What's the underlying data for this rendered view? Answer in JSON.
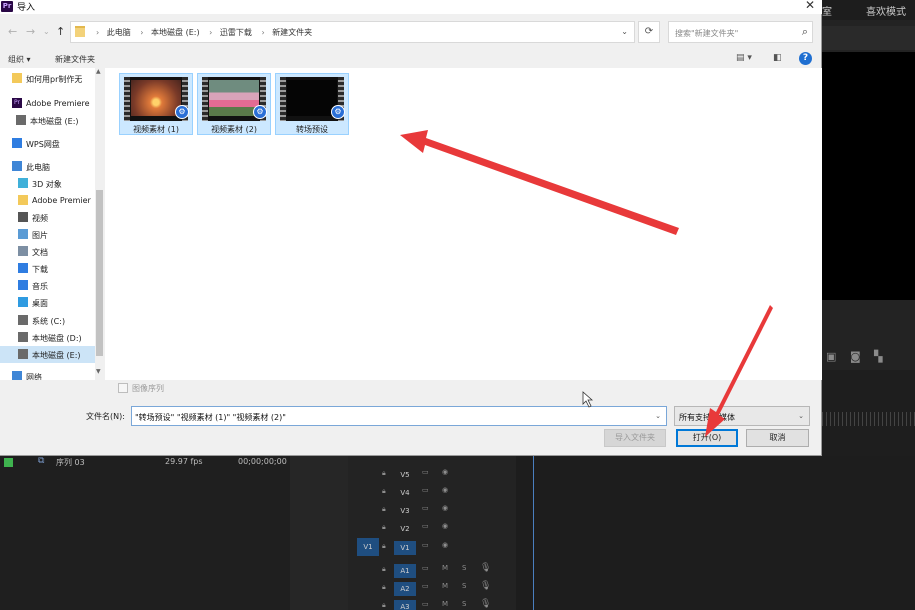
{
  "premiere": {
    "top_right_items": [
      "室",
      "喜欢模式"
    ],
    "project": {
      "sequence": "序列 03",
      "fps": "29.97 fps",
      "timecode": "00;00;00;00"
    },
    "tracks": [
      {
        "name": "V5"
      },
      {
        "name": "V4"
      },
      {
        "name": "V3"
      },
      {
        "name": "V2"
      },
      {
        "name": "V1",
        "source": "V1"
      },
      {
        "name": "A1"
      },
      {
        "name": "A2"
      },
      {
        "name": "A3"
      }
    ],
    "track_toggles": {
      "mute": "M",
      "solo": "S"
    }
  },
  "dialog": {
    "title": "导入",
    "app_icon_text": "Pr",
    "close_glyph": "✕",
    "nav": {
      "back": "←",
      "forward": "→",
      "recent": "⌄",
      "up": "↑"
    },
    "address": {
      "crumbs": [
        "此电脑",
        "本地磁盘 (E:)",
        "迅雷下载",
        "新建文件夹"
      ],
      "separator": "›",
      "dropdown": "⌄"
    },
    "refresh_glyph": "⟳",
    "search": {
      "placeholder": "搜索\"新建文件夹\"",
      "glyph": "⌕"
    },
    "toolbar": {
      "organize": "组织 ▾",
      "new_folder": "新建文件夹",
      "help": "?"
    },
    "sidebar": {
      "items": [
        {
          "label": "如何用pr制作无",
          "icon": "folder-icon"
        },
        {
          "label": "Adobe Premiere",
          "icon": "premiere-icon"
        },
        {
          "label": "本地磁盘 (E:)",
          "icon": "drive-icon"
        },
        {
          "label": "WPS网盘",
          "icon": "cloud-icon"
        },
        {
          "label": "此电脑",
          "icon": "computer-icon"
        },
        {
          "label": "3D 对象",
          "icon": "cube-icon"
        },
        {
          "label": "Adobe Premier",
          "icon": "folder-icon"
        },
        {
          "label": "视频",
          "icon": "video-icon"
        },
        {
          "label": "图片",
          "icon": "picture-icon"
        },
        {
          "label": "文档",
          "icon": "document-icon"
        },
        {
          "label": "下载",
          "icon": "download-icon"
        },
        {
          "label": "音乐",
          "icon": "music-icon"
        },
        {
          "label": "桌面",
          "icon": "desktop-icon"
        },
        {
          "label": "系统 (C:)",
          "icon": "drive-icon"
        },
        {
          "label": "本地磁盘 (D:)",
          "icon": "drive-icon"
        },
        {
          "label": "本地磁盘 (E:)",
          "icon": "drive-icon",
          "selected": true
        },
        {
          "label": "网络",
          "icon": "network-icon"
        }
      ]
    },
    "files": [
      {
        "label": "视频素材 (1)",
        "thumb": "sunset",
        "selected": true
      },
      {
        "label": "视频素材 (2)",
        "thumb": "flowers",
        "selected": true
      },
      {
        "label": "转场预设",
        "thumb": "black",
        "selected": true
      }
    ],
    "image_sequence_label": "图像序列",
    "filename_label": "文件名(N):",
    "filename_value": "\"转场预设\" \"视频素材 (1)\" \"视频素材 (2)\"",
    "filetype_value": "所有支持的媒体",
    "buttons": {
      "import_folder": "导入文件夹",
      "open": "打开(O)",
      "cancel": "取消"
    }
  },
  "annotations": {
    "arrow_color": "#e8393a"
  }
}
